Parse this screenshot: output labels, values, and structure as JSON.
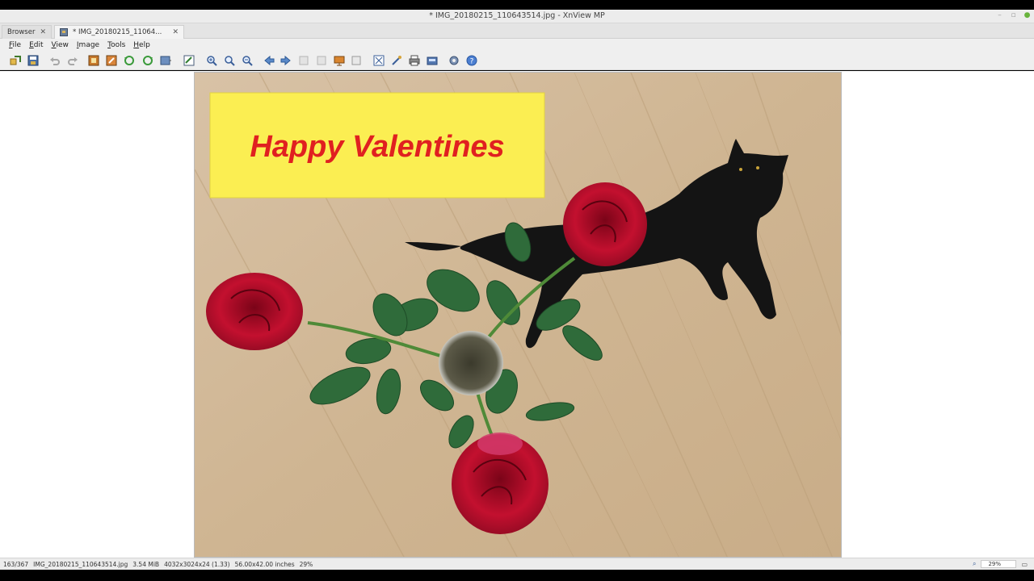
{
  "window": {
    "title": "* IMG_20180215_110643514.jpg - XnView MP"
  },
  "tabs": [
    {
      "label": "Browser",
      "close": "✕"
    },
    {
      "label": "* IMG_20180215_11064...",
      "close": "✕"
    }
  ],
  "menu": [
    "File",
    "Edit",
    "View",
    "Image",
    "Tools",
    "Help"
  ],
  "toolbar": {
    "icons": [
      "browse-icon",
      "save-icon",
      "undo-icon",
      "redo-icon",
      "crop-icon",
      "resize-icon",
      "rotate-left-icon",
      "rotate-right-icon",
      "adjust-icon",
      "edit-icon",
      "zoom-in-icon",
      "zoom-fit-icon",
      "zoom-out-icon",
      "previous-icon",
      "next-icon",
      "first-icon",
      "last-icon",
      "slideshow-icon",
      "fullscreen-icon",
      "fit-window-icon",
      "tools-icon",
      "print-icon",
      "scan-icon",
      "settings-icon",
      "help-icon"
    ]
  },
  "photo": {
    "caption": "Happy Valentines",
    "caption_color": "#e02020",
    "caption_bg": "#fbee52"
  },
  "status": {
    "position": "163/367",
    "filename": "IMG_20180215_110643514.jpg",
    "filesize": "3.54 MiB",
    "dimensions": "4032x3024x24 (1.33)",
    "print_size": "56.00x42.00 inches",
    "zoom": "29%",
    "zoom_field": "29%"
  }
}
